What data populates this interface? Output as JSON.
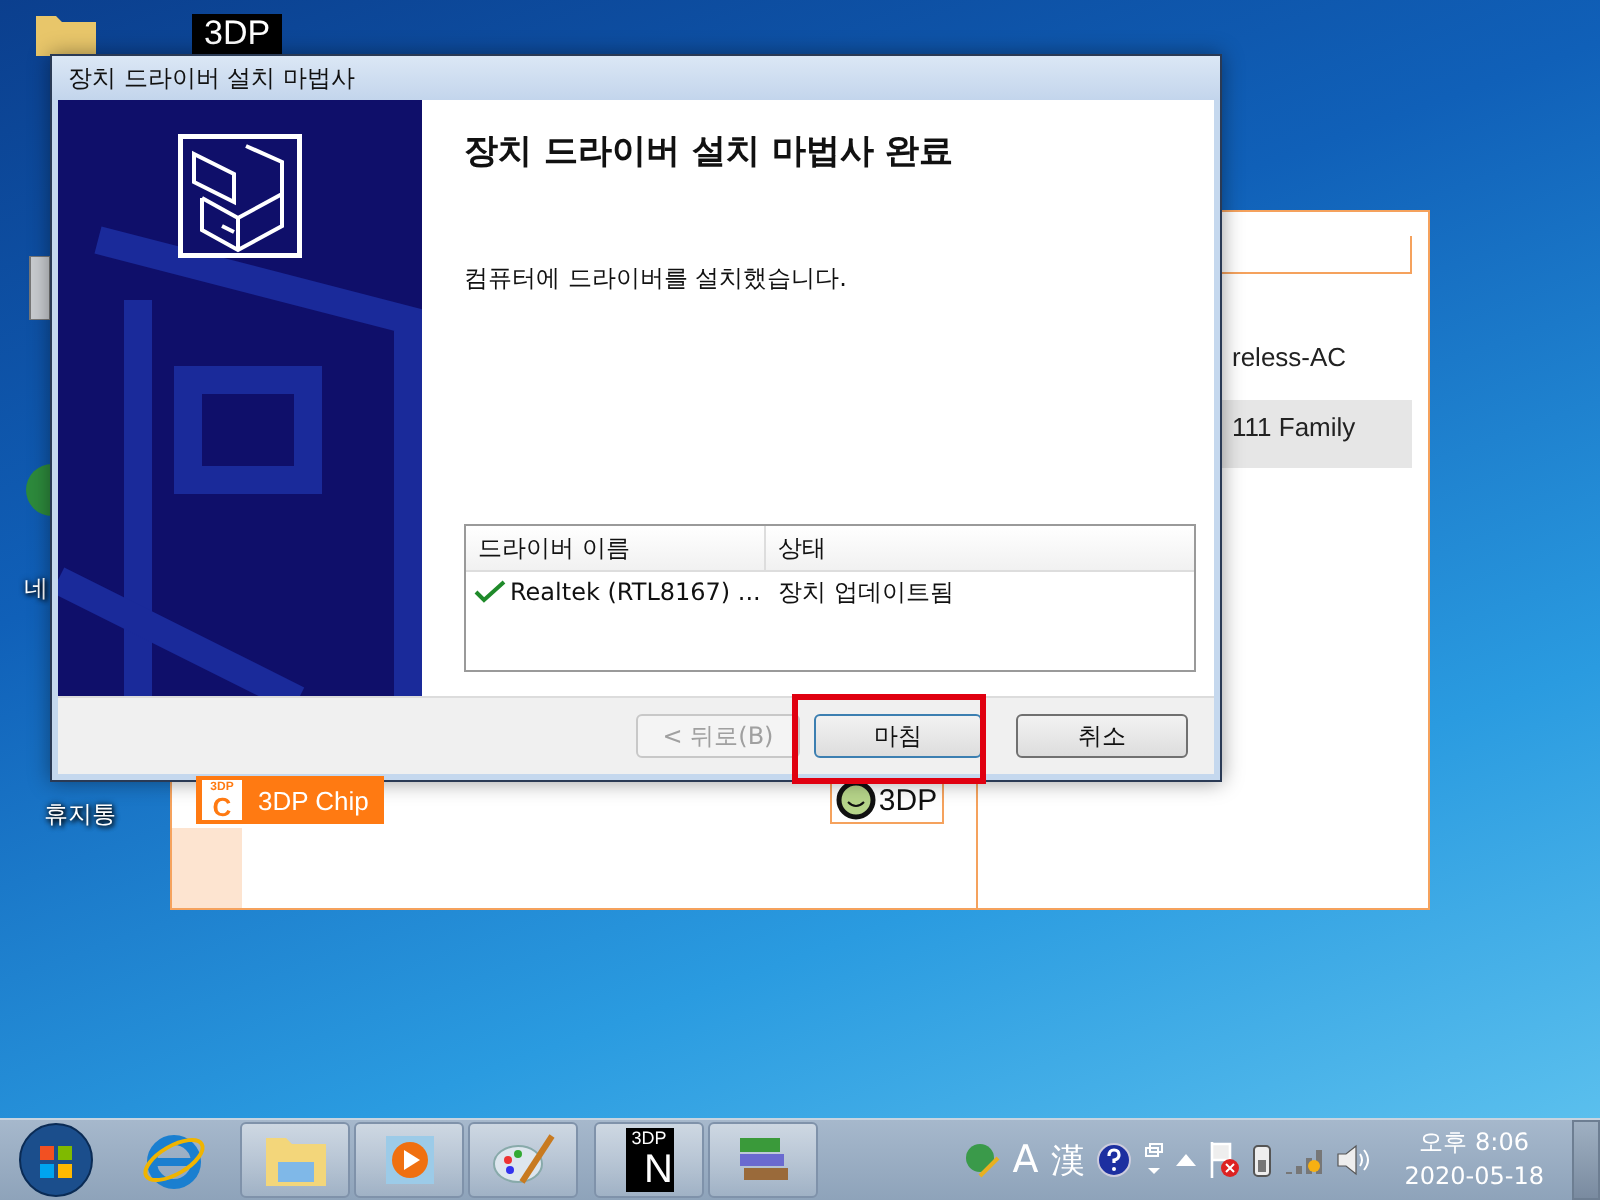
{
  "desktop_icons": [
    {
      "kind": "folder"
    },
    {
      "kind": "badge",
      "text": "3DP"
    },
    {
      "kind": "computer"
    },
    {
      "kind": "globe",
      "label": "네"
    },
    {
      "kind": "trash",
      "label": "휴지통"
    }
  ],
  "background_window": {
    "lines": [
      {
        "text": "reless-AC",
        "selected": false
      },
      {
        "text": "111 Family",
        "selected": true
      }
    ],
    "buttons": [
      {
        "kind": "chip",
        "label": "3DP Chip",
        "icon_text": [
          "3DP",
          "C"
        ]
      },
      {
        "kind": "face",
        "label": "3DP"
      }
    ]
  },
  "dialog": {
    "title": "장치 드라이버 설치 마법사",
    "heading": "장치 드라이버 설치 마법사 완료",
    "message": "컴퓨터에 드라이버를 설치했습니다.",
    "driver_list": {
      "columns": [
        "드라이버 이름",
        "상태"
      ],
      "rows": [
        {
          "name": "Realtek (RTL8167) ...",
          "status": "장치 업데이트됨",
          "success": true
        }
      ]
    },
    "buttons": [
      {
        "label": "< 뒤로(B)",
        "disabled": true,
        "default": false,
        "highlighted": false
      },
      {
        "label": "마침",
        "disabled": false,
        "default": true,
        "highlighted": true
      },
      {
        "label": "취소",
        "disabled": false,
        "default": false,
        "highlighted": false
      }
    ]
  },
  "taskbar": {
    "items": [
      {
        "kind": "start"
      },
      {
        "kind": "ie"
      },
      {
        "kind": "explorer"
      },
      {
        "kind": "media"
      },
      {
        "kind": "paint"
      },
      {
        "kind": "badge",
        "text": [
          "3DP",
          "N"
        ]
      },
      {
        "kind": "tool"
      }
    ],
    "language": [
      "A",
      "漢"
    ],
    "clock": {
      "time": "오후 8:06",
      "date": "2020-05-18"
    }
  }
}
